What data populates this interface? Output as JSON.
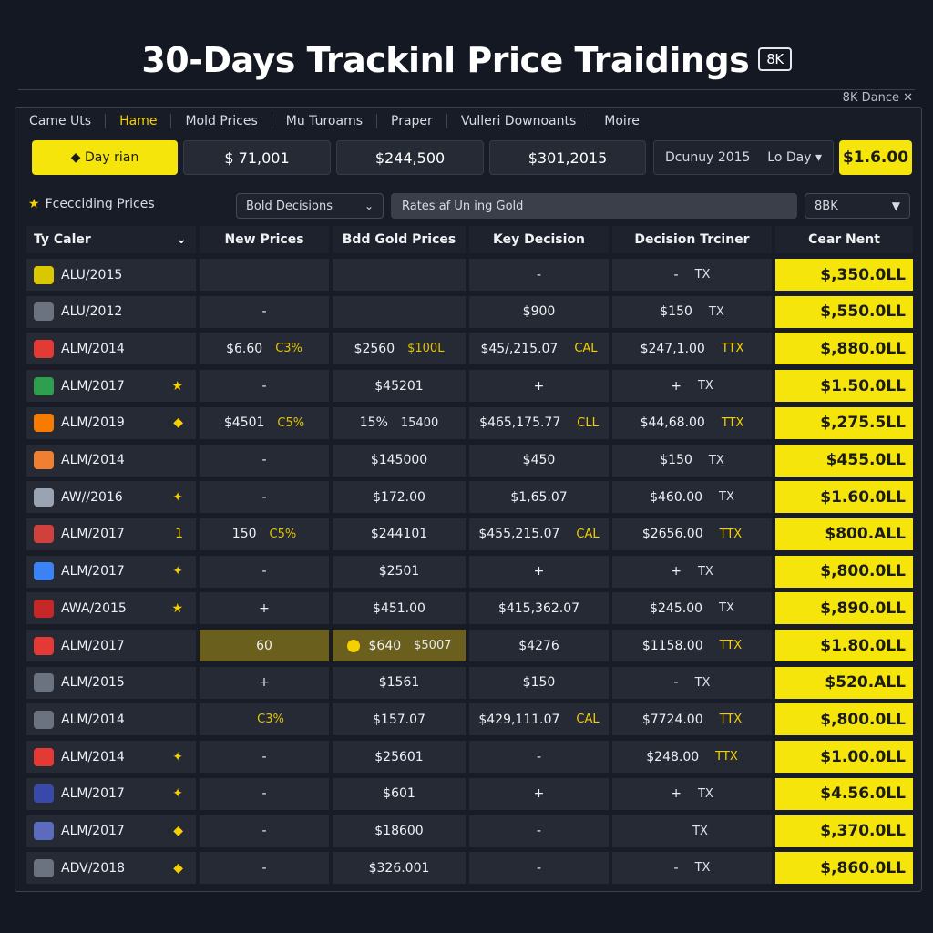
{
  "header": {
    "title": "30-Days Trackinl Price Traidings",
    "badge": "8K",
    "corner_note": "8K Dance ✕"
  },
  "nav": [
    "Came Uts",
    "Hame",
    "Mold Prices",
    "Mu Turoams",
    "Praper",
    "Vulleri Downoants",
    "Moire"
  ],
  "nav_active": 1,
  "summary": {
    "button": "◆ Day rian",
    "values": [
      "$ 71,001",
      "$244,500",
      "$301,2015"
    ],
    "period_label": "Dcunuy 2015",
    "period_select": "Lo Day ▾",
    "total": "$1.6.00"
  },
  "filters": {
    "label": "Fcecciding Prices",
    "dropdown": "Bold Decisions",
    "search": "Rates af Un ing Gold",
    "quality": "8BK"
  },
  "table": {
    "headers": [
      "Ty Caler",
      "New Prices",
      "Bdd Gold Prices",
      "Key Decision",
      "Decision Trciner",
      "Cear Nent"
    ],
    "rows": [
      {
        "name": "ALU/2015",
        "mark": "",
        "c1": "",
        "c1s": "",
        "c2": "",
        "c2s": "",
        "c3": "-",
        "c3s": "",
        "c4": "-",
        "c4s": "TX",
        "c5": "$,350.0LL"
      },
      {
        "name": "ALU/2012",
        "mark": "",
        "c1": "-",
        "c1s": "",
        "c2": "",
        "c2s": "",
        "c3": "$900",
        "c3s": "",
        "c4": "$150",
        "c4s": "TX",
        "c5": "$,550.0LL"
      },
      {
        "name": "ALM/2014",
        "mark": "",
        "c1": "$6.60",
        "c1s": "C3%",
        "c2": "$2560",
        "c2s": "$100L",
        "c3": "$45/,215.07",
        "c3s": "CAL",
        "c4": "$247,1.00",
        "c4s": "TTX",
        "c5": "$,880.0LL"
      },
      {
        "name": "ALM/2017",
        "mark": "★",
        "c1": "-",
        "c1s": "",
        "c2": "$45201",
        "c2s": "",
        "c3": "+",
        "c3s": "",
        "c4": "+",
        "c4s": "TX",
        "c5": "$1.50.0LL"
      },
      {
        "name": "ALM/2019",
        "mark": "◆",
        "c1": "$4501",
        "c1s": "C5%",
        "c2": "15%",
        "c2s": "15400",
        "c3": "$465,175.77",
        "c3s": "CLL",
        "c4": "$44,68.00",
        "c4s": "TTX",
        "c5": "$,275.5LL"
      },
      {
        "name": "ALM/2014",
        "mark": "",
        "c1": "-",
        "c1s": "",
        "c2": "$145000",
        "c2s": "",
        "c3": "$450",
        "c3s": "",
        "c4": "$150",
        "c4s": "TX",
        "c5": "$455.0LL"
      },
      {
        "name": "AW//2016",
        "mark": "✦",
        "c1": "-",
        "c1s": "",
        "c2": "$172.00",
        "c2s": "",
        "c3": "$1,65.07",
        "c3s": "",
        "c4": "$460.00",
        "c4s": "TX",
        "c5": "$1.60.0LL"
      },
      {
        "name": "ALM/2017",
        "mark": "1",
        "c1": "150",
        "c1s": "C5%",
        "c2": "$244101",
        "c2s": "",
        "c3": "$455,215.07",
        "c3s": "CAL",
        "c4": "$2656.00",
        "c4s": "TTX",
        "c5": "$800.ALL"
      },
      {
        "name": "ALM/2017",
        "mark": "✦",
        "c1": "-",
        "c1s": "",
        "c2": "$2501",
        "c2s": "",
        "c3": "+",
        "c3s": "",
        "c4": "+",
        "c4s": "TX",
        "c5": "$,800.0LL"
      },
      {
        "name": "AWA/2015",
        "mark": "★",
        "c1": "+",
        "c1s": "",
        "c2": "$451.00",
        "c2s": "",
        "c3": "$415,362.07",
        "c3s": "",
        "c4": "$245.00",
        "c4s": "TX",
        "c5": "$,890.0LL"
      },
      {
        "name": "ALM/2017",
        "mark": "",
        "c1": "60",
        "c1s": "",
        "c2": "$640",
        "c2s": "$5007",
        "c3": "$4276",
        "c3s": "",
        "c4": "$1158.00",
        "c4s": "TTX",
        "c5": "$1.80.0LL"
      },
      {
        "name": "ALM/2015",
        "mark": "",
        "c1": "+",
        "c1s": "",
        "c2": "$1561",
        "c2s": "",
        "c3": "$150",
        "c3s": "",
        "c4": "-",
        "c4s": "TX",
        "c5": "$520.ALL"
      },
      {
        "name": "ALM/2014",
        "mark": "",
        "c1": "",
        "c1s": "C3%",
        "c2": "$157.07",
        "c2s": "",
        "c3": "$429,111.07",
        "c3s": "CAL",
        "c4": "$7724.00",
        "c4s": "TTX",
        "c5": "$,800.0LL"
      },
      {
        "name": "ALM/2014",
        "mark": "✦",
        "c1": "-",
        "c1s": "",
        "c2": "$25601",
        "c2s": "",
        "c3": "-",
        "c3s": "",
        "c4": "$248.00",
        "c4s": "TTX",
        "c5": "$1.00.0LL"
      },
      {
        "name": "ALM/2017",
        "mark": "✦",
        "c1": "-",
        "c1s": "",
        "c2": "$601",
        "c2s": "",
        "c3": "+",
        "c3s": "",
        "c4": "+",
        "c4s": "TX",
        "c5": "$4.56.0LL"
      },
      {
        "name": "ALM/2017",
        "mark": "◆",
        "c1": "-",
        "c1s": "",
        "c2": "$18600",
        "c2s": "",
        "c3": "-",
        "c3s": "",
        "c4": "",
        "c4s": "TX",
        "c5": "$,370.0LL"
      },
      {
        "name": "ADV/2018",
        "mark": "◆",
        "c1": "-",
        "c1s": "",
        "c2": "$326.001",
        "c2s": "",
        "c3": "-",
        "c3s": "",
        "c4": "-",
        "c4s": "TX",
        "c5": "$,860.0LL"
      }
    ]
  },
  "colors": {
    "accent": "#f5e50a",
    "background": "#141822",
    "cell": "#252a35",
    "highlight": "#6b5f1e",
    "flags": [
      "#d9c800",
      "#6b7280",
      "#e53935",
      "#2e9e4f",
      "#f57c00",
      "#f08030",
      "#9aa3b2",
      "#d0403c",
      "#3b82f6",
      "#c62828",
      "#e53935",
      "#6b7280",
      "#6b7280",
      "#e53935",
      "#3949ab",
      "#5c6bc0",
      "#6b7280"
    ]
  }
}
